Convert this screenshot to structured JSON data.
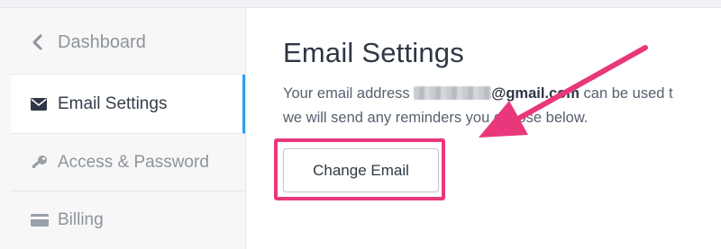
{
  "sidebar": {
    "back": {
      "label": "Dashboard",
      "icon": "chevron-left-icon"
    },
    "items": [
      {
        "label": "Email Settings",
        "icon": "envelope-icon",
        "active": true
      },
      {
        "label": "Access & Password",
        "icon": "key-icon"
      },
      {
        "label": "Billing",
        "icon": "credit-card-icon"
      }
    ]
  },
  "main": {
    "title": "Email Settings",
    "line1_prefix": "Your email address ",
    "email_domain": "@gmail.com",
    "line1_suffix": " can be used t",
    "line2": "we will send any reminders you choose below.",
    "change_button": "Change Email"
  },
  "annotation": {
    "color": "#e8387b"
  },
  "colors": {
    "accent": "#2c9ff0",
    "sidebar_bg": "#f7f7f8"
  }
}
